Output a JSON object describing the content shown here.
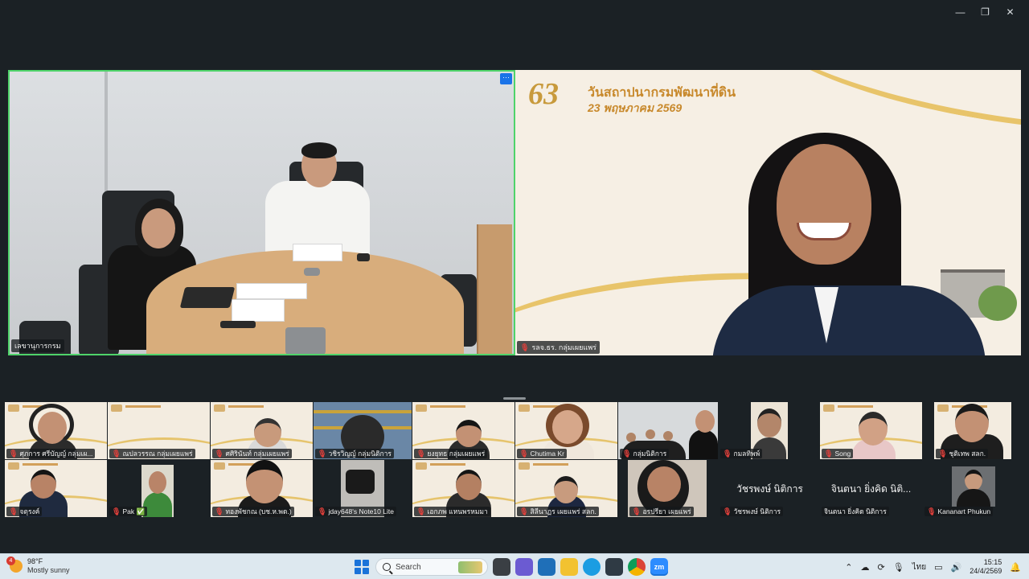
{
  "window": {
    "minimize_icon": "minimize-icon",
    "restore_icon": "restore-icon",
    "close_icon": "close-icon",
    "minimize_glyph": "—",
    "restore_glyph": "❐",
    "close_glyph": "✕"
  },
  "speakers": {
    "left": {
      "name": "เลขานุการกรม",
      "more_label": "···"
    },
    "right": {
      "name": "รลจ.ธร. กลุ่มเผยแพร่",
      "banner_logo": "63",
      "banner_title": "วันสถาปนากรมพัฒนาที่ดิน",
      "banner_date": "23 พฤษภาคม 2569"
    }
  },
  "gallery": [
    {
      "name": "ศุภการ ศรีบัญญ์ กลุ่มเผ...",
      "muted": true
    },
    {
      "name": "ณปลวรรณ กลุ่มเผยแพร่",
      "muted": true
    },
    {
      "name": "ศศิรินันท์ กลุ่มเผยแพร่",
      "muted": true
    },
    {
      "name": "วชิรวิญญ์ กลุ่มนิติการ",
      "muted": true
    },
    {
      "name": "ยงยุทธ กลุ่มเผยแพร่",
      "muted": true
    },
    {
      "name": "Chutima Kr",
      "muted": true
    },
    {
      "name": "กลุ่มนิติการ",
      "muted": true
    },
    {
      "name": "กมลทิพพ์",
      "muted": true
    },
    {
      "name": "Song",
      "muted": true
    },
    {
      "name": "ชุติเทพ สลก.",
      "muted": true
    },
    {
      "name": "จตุรงค์",
      "muted": true
    },
    {
      "name": "Pak ✅",
      "muted": true
    },
    {
      "name": "ทองพัชกณ (บช.ห.พด.)",
      "muted": true
    },
    {
      "name": "jday648's Note10 Lite",
      "muted": true
    },
    {
      "name": "เอกภพ แหนพรหมมา",
      "muted": true
    },
    {
      "name": "สิลีนาฏร เผยแพร่ สลก.",
      "muted": true
    },
    {
      "name": "อรปรียา เผยแพร่",
      "muted": true
    },
    {
      "name": "วัชรพงษ์ นิติการ",
      "muted": true,
      "display": "วัชรพงษ์ นิติการ"
    },
    {
      "name": "จินตนา ยิ่งคิด นิติการ",
      "muted": false,
      "display": "จินตนา ยิ่งคิด นิติ..."
    },
    {
      "name": "Kananart Phukun",
      "muted": true
    }
  ],
  "mute_glyph": "🎙",
  "taskbar": {
    "weather_badge": "4",
    "temperature": "98°F",
    "weather": "Mostly sunny",
    "search_label": "Search",
    "zoom_label": "zm",
    "language": "ไทย",
    "time": "15:15",
    "date": "24/4/2569"
  }
}
